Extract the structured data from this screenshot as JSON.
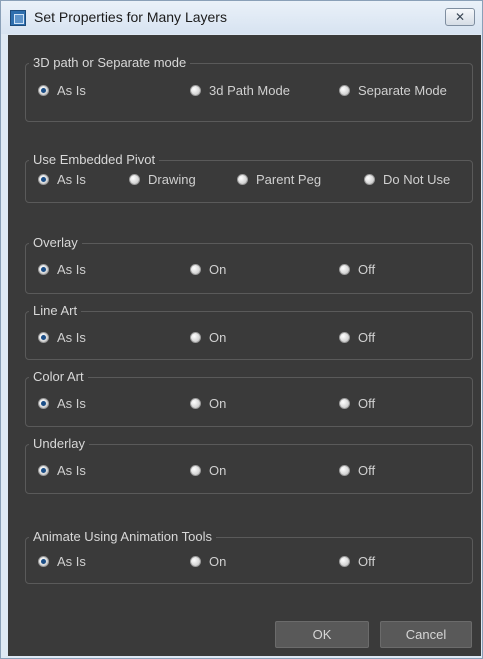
{
  "window": {
    "title": "Set Properties for Many Layers",
    "close_glyph": "✕",
    "icon": "app-icon"
  },
  "groups": [
    {
      "key": "mode",
      "title": "3D path or Separate mode",
      "options": [
        {
          "label": "As Is",
          "checked": true
        },
        {
          "label": "3d Path Mode",
          "checked": false
        },
        {
          "label": "Separate Mode",
          "checked": false
        }
      ]
    },
    {
      "key": "pivot",
      "title": "Use Embedded Pivot",
      "options": [
        {
          "label": "As Is",
          "checked": true
        },
        {
          "label": "Drawing",
          "checked": false
        },
        {
          "label": "Parent Peg",
          "checked": false
        },
        {
          "label": "Do Not Use",
          "checked": false
        }
      ]
    },
    {
      "key": "overlay",
      "title": "Overlay",
      "options": [
        {
          "label": "As Is",
          "checked": true
        },
        {
          "label": "On",
          "checked": false
        },
        {
          "label": "Off",
          "checked": false
        }
      ]
    },
    {
      "key": "line-art",
      "title": "Line Art",
      "options": [
        {
          "label": "As Is",
          "checked": true
        },
        {
          "label": "On",
          "checked": false
        },
        {
          "label": "Off",
          "checked": false
        }
      ]
    },
    {
      "key": "color-art",
      "title": "Color Art",
      "options": [
        {
          "label": "As Is",
          "checked": true
        },
        {
          "label": "On",
          "checked": false
        },
        {
          "label": "Off",
          "checked": false
        }
      ]
    },
    {
      "key": "underlay",
      "title": "Underlay",
      "options": [
        {
          "label": "As Is",
          "checked": true
        },
        {
          "label": "On",
          "checked": false
        },
        {
          "label": "Off",
          "checked": false
        }
      ]
    },
    {
      "key": "animate",
      "title": "Animate Using Animation Tools",
      "options": [
        {
          "label": "As Is",
          "checked": true
        },
        {
          "label": "On",
          "checked": false
        },
        {
          "label": "Off",
          "checked": false
        }
      ]
    }
  ],
  "buttons": {
    "ok": "OK",
    "cancel": "Cancel"
  }
}
